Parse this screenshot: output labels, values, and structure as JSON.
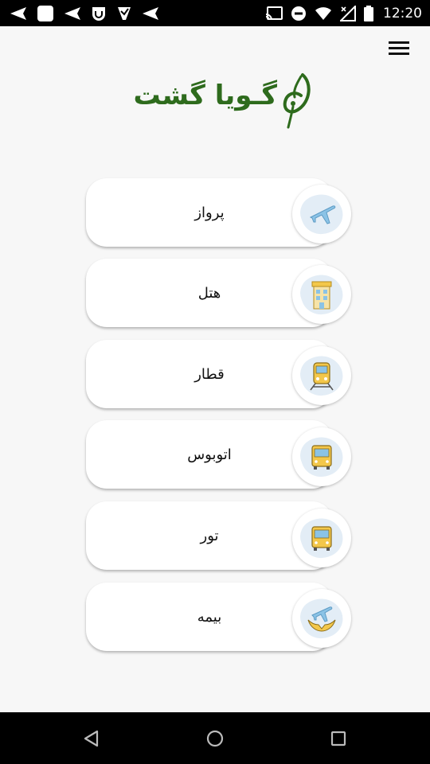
{
  "status_bar": {
    "time": "12:20",
    "left_icons": [
      "send-icon",
      "square-app-icon",
      "send-icon",
      "shield-app-icon",
      "checkmark-app-icon",
      "send-icon"
    ],
    "right_icons": [
      "cast-icon",
      "do-not-disturb-icon",
      "wifi-icon",
      "no-signal-icon",
      "battery-icon"
    ]
  },
  "header": {
    "menu_icon": "hamburger-menu-icon",
    "logo_text": "گـویا گشت",
    "brand_color": "#2e6b1d"
  },
  "services": [
    {
      "label": "پرواز",
      "icon": "airplane-icon"
    },
    {
      "label": "هتل",
      "icon": "hotel-icon"
    },
    {
      "label": "قطار",
      "icon": "train-icon"
    },
    {
      "label": "اتوبوس",
      "icon": "bus-icon"
    },
    {
      "label": "تور",
      "icon": "tour-bus-icon"
    },
    {
      "label": "بیمه",
      "icon": "insurance-icon"
    }
  ],
  "nav_bar": {
    "buttons": [
      "back-icon",
      "home-icon",
      "recents-icon"
    ]
  }
}
